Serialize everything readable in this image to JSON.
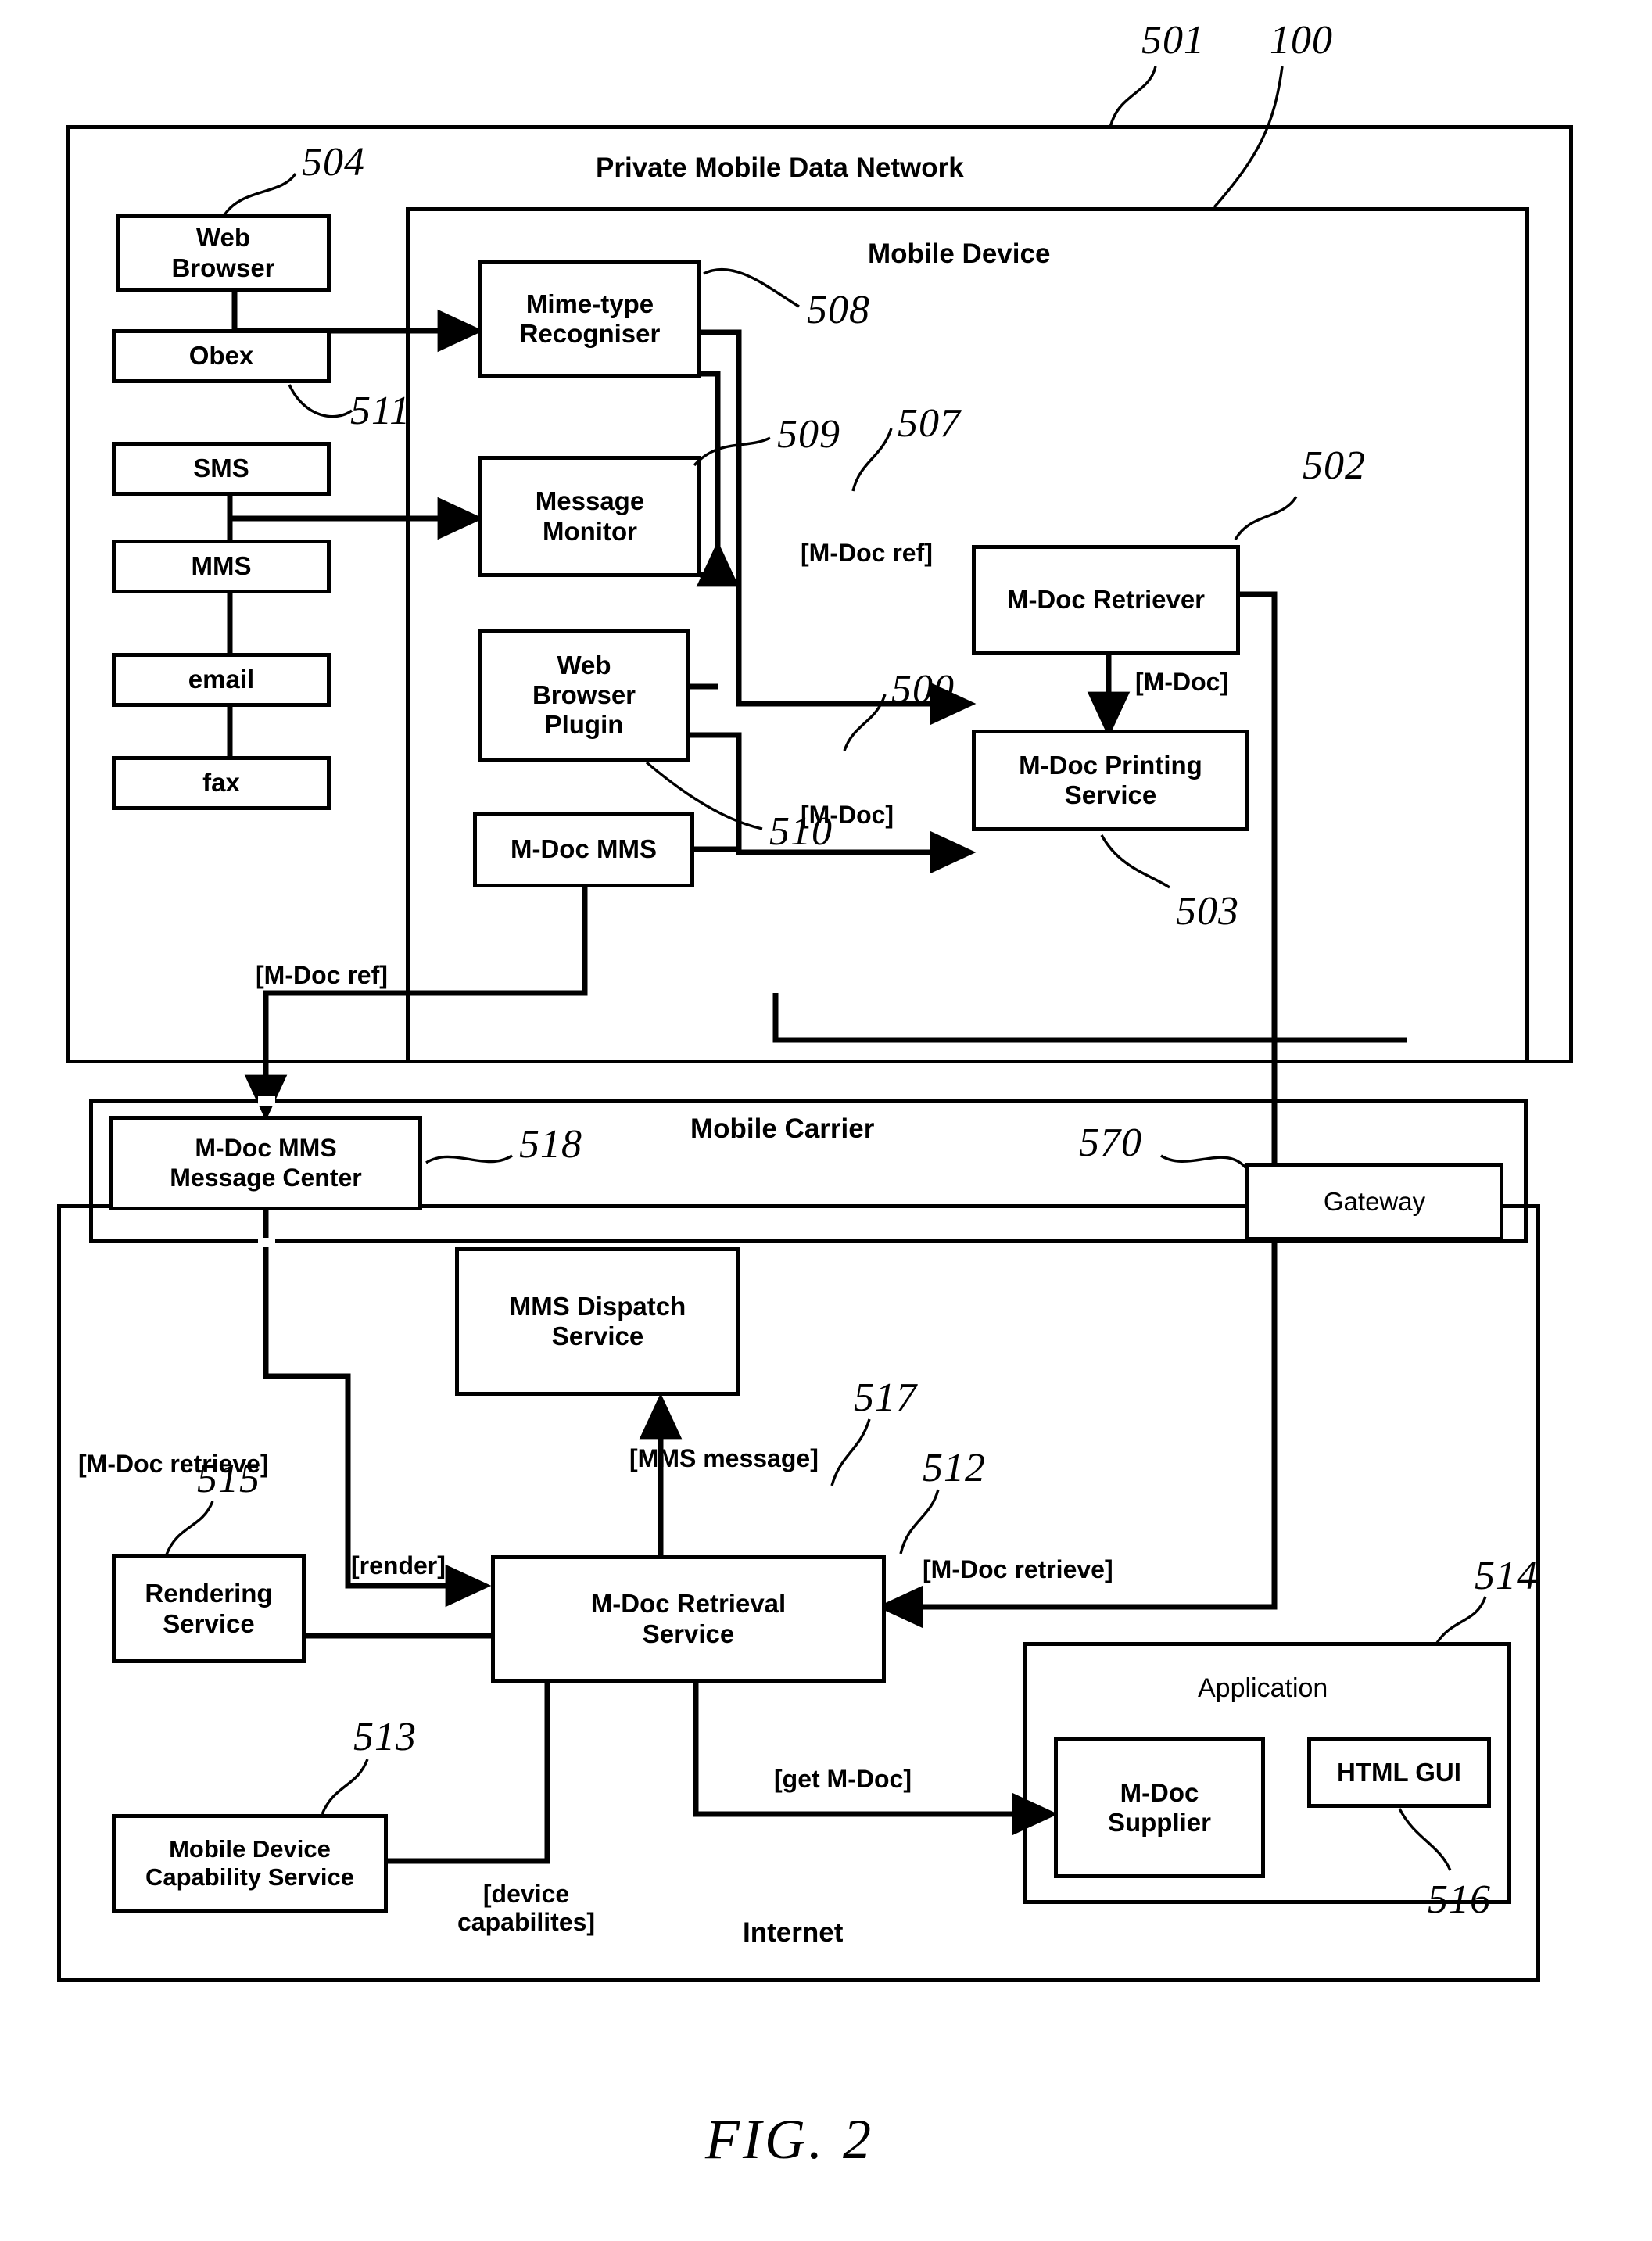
{
  "figure": {
    "caption": "FIG. 2"
  },
  "regions": [
    {
      "id": "private-mobile-data-network",
      "title": "Private Mobile Data Network",
      "ref": "501"
    },
    {
      "id": "mobile-device",
      "title": "Mobile Device",
      "ref": "100"
    },
    {
      "id": "mobile-carrier",
      "title": "Mobile Carrier",
      "ref": ""
    },
    {
      "id": "internet",
      "title": "Internet",
      "ref": ""
    },
    {
      "id": "application",
      "title": "Application",
      "ref": "514"
    }
  ],
  "nodes": [
    {
      "id": "web-browser",
      "label": "Web\nBrowser",
      "ref": "504"
    },
    {
      "id": "obex",
      "label": "Obex",
      "ref": "511"
    },
    {
      "id": "sms",
      "label": "SMS",
      "ref": ""
    },
    {
      "id": "mms",
      "label": "MMS",
      "ref": ""
    },
    {
      "id": "email",
      "label": "email",
      "ref": ""
    },
    {
      "id": "fax",
      "label": "fax",
      "ref": ""
    },
    {
      "id": "mime-type-recogniser",
      "label": "Mime-type\nRecogniser",
      "ref": "508"
    },
    {
      "id": "message-monitor",
      "label": "Message\nMonitor",
      "ref": "509"
    },
    {
      "id": "web-browser-plugin",
      "label": "Web\nBrowser\nPlugin",
      "ref": "510"
    },
    {
      "id": "m-doc-mms",
      "label": "M-Doc MMS",
      "ref": ""
    },
    {
      "id": "m-doc-retriever",
      "label": "M-Doc Retriever",
      "ref": "502"
    },
    {
      "id": "m-doc-printing-service",
      "label": "M-Doc Printing\nService",
      "ref": "503"
    },
    {
      "id": "m-doc-mms-message-center",
      "label": "M-Doc MMS\nMessage Center",
      "ref": "518"
    },
    {
      "id": "gateway",
      "label": "Gateway",
      "ref": "570"
    },
    {
      "id": "mms-dispatch-service",
      "label": "MMS Dispatch\nService",
      "ref": ""
    },
    {
      "id": "rendering-service",
      "label": "Rendering\nService",
      "ref": "515"
    },
    {
      "id": "m-doc-retrieval-service",
      "label": "M-Doc Retrieval\nService",
      "ref": "512"
    },
    {
      "id": "mobile-device-capability-service",
      "label": "Mobile Device\nCapability Service",
      "ref": "513"
    },
    {
      "id": "m-doc-supplier",
      "label": "M-Doc\nSupplier",
      "ref": ""
    },
    {
      "id": "html-gui",
      "label": "HTML GUI",
      "ref": "516"
    }
  ],
  "edge_labels": [
    {
      "id": "m-doc-ref-retriever",
      "text": "[M-Doc ref]",
      "ref": "507"
    },
    {
      "id": "m-doc-printing",
      "text": "[M-Doc]",
      "ref": "500"
    },
    {
      "id": "m-doc-retriever-out",
      "text": "[M-Doc]",
      "ref": ""
    },
    {
      "id": "m-doc-ref-carrier",
      "text": "[M-Doc ref]",
      "ref": ""
    },
    {
      "id": "m-doc-retrieve-left",
      "text": "[M-Doc retrieve]",
      "ref": ""
    },
    {
      "id": "m-doc-retrieve-right",
      "text": "[M-Doc retrieve]",
      "ref": ""
    },
    {
      "id": "mms-message",
      "text": "[MMS message]",
      "ref": "517"
    },
    {
      "id": "render",
      "text": "[render]",
      "ref": ""
    },
    {
      "id": "get-m-doc",
      "text": "[get M-Doc]",
      "ref": ""
    },
    {
      "id": "device-capabilites",
      "text": "[device\ncapabilites]",
      "ref": ""
    }
  ],
  "reference_numerals": [
    "100",
    "500",
    "501",
    "502",
    "503",
    "504",
    "507",
    "508",
    "509",
    "510",
    "511",
    "512",
    "513",
    "514",
    "515",
    "516",
    "517",
    "518",
    "570"
  ],
  "colors": {
    "ink": "#000000",
    "paper": "#ffffff"
  }
}
